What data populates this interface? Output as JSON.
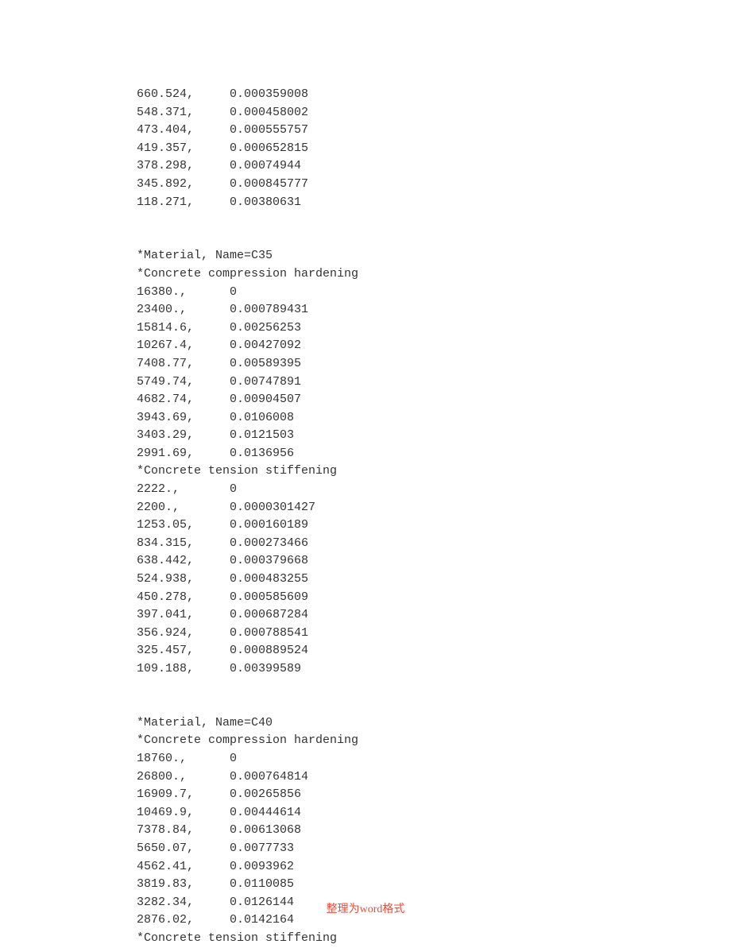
{
  "footer": "整理为word格式",
  "blocks": [
    {
      "rows": [
        [
          "660.524,",
          "0.000359008"
        ],
        [
          "548.371,",
          "0.000458002"
        ],
        [
          "473.404,",
          "0.000555757"
        ],
        [
          "419.357,",
          "0.000652815"
        ],
        [
          "378.298,",
          "0.00074944"
        ],
        [
          "345.892,",
          "0.000845777"
        ],
        [
          "118.271,",
          "0.00380631"
        ]
      ]
    },
    {
      "blank": 2
    },
    {
      "header": "*Material, Name=C35"
    },
    {
      "header": "*Concrete compression hardening"
    },
    {
      "rows": [
        [
          "16380.,",
          "0"
        ],
        [
          "23400.,",
          "0.000789431"
        ],
        [
          "15814.6,",
          "0.00256253"
        ],
        [
          "10267.4,",
          "0.00427092"
        ],
        [
          "7408.77,",
          "0.00589395"
        ],
        [
          "5749.74,",
          "0.00747891"
        ],
        [
          "4682.74,",
          "0.00904507"
        ],
        [
          "3943.69,",
          "0.0106008"
        ],
        [
          "3403.29,",
          "0.0121503"
        ],
        [
          "2991.69,",
          "0.0136956"
        ]
      ]
    },
    {
      "header": "*Concrete tension stiffening"
    },
    {
      "rows": [
        [
          "2222.,",
          "0"
        ],
        [
          "2200.,",
          "0.0000301427"
        ],
        [
          "1253.05,",
          "0.000160189"
        ],
        [
          "834.315,",
          "0.000273466"
        ],
        [
          "638.442,",
          "0.000379668"
        ],
        [
          "524.938,",
          "0.000483255"
        ],
        [
          "450.278,",
          "0.000585609"
        ],
        [
          "397.041,",
          "0.000687284"
        ],
        [
          "356.924,",
          "0.000788541"
        ],
        [
          "325.457,",
          "0.000889524"
        ],
        [
          "109.188,",
          "0.00399589"
        ]
      ]
    },
    {
      "blank": 2
    },
    {
      "header": "*Material, Name=C40"
    },
    {
      "header": "*Concrete compression hardening"
    },
    {
      "rows": [
        [
          "18760.,",
          "0"
        ],
        [
          "26800.,",
          "0.000764814"
        ],
        [
          "16909.7,",
          "0.00265856"
        ],
        [
          "10469.9,",
          "0.00444614"
        ],
        [
          "7378.84,",
          "0.00613068"
        ],
        [
          "5650.07,",
          "0.0077733"
        ],
        [
          "4562.41,",
          "0.0093962"
        ],
        [
          "3819.83,",
          "0.0110085"
        ],
        [
          "3282.34,",
          "0.0126144"
        ],
        [
          "2876.02,",
          "0.0142164"
        ]
      ]
    },
    {
      "header": "*Concrete tension stiffening"
    }
  ]
}
